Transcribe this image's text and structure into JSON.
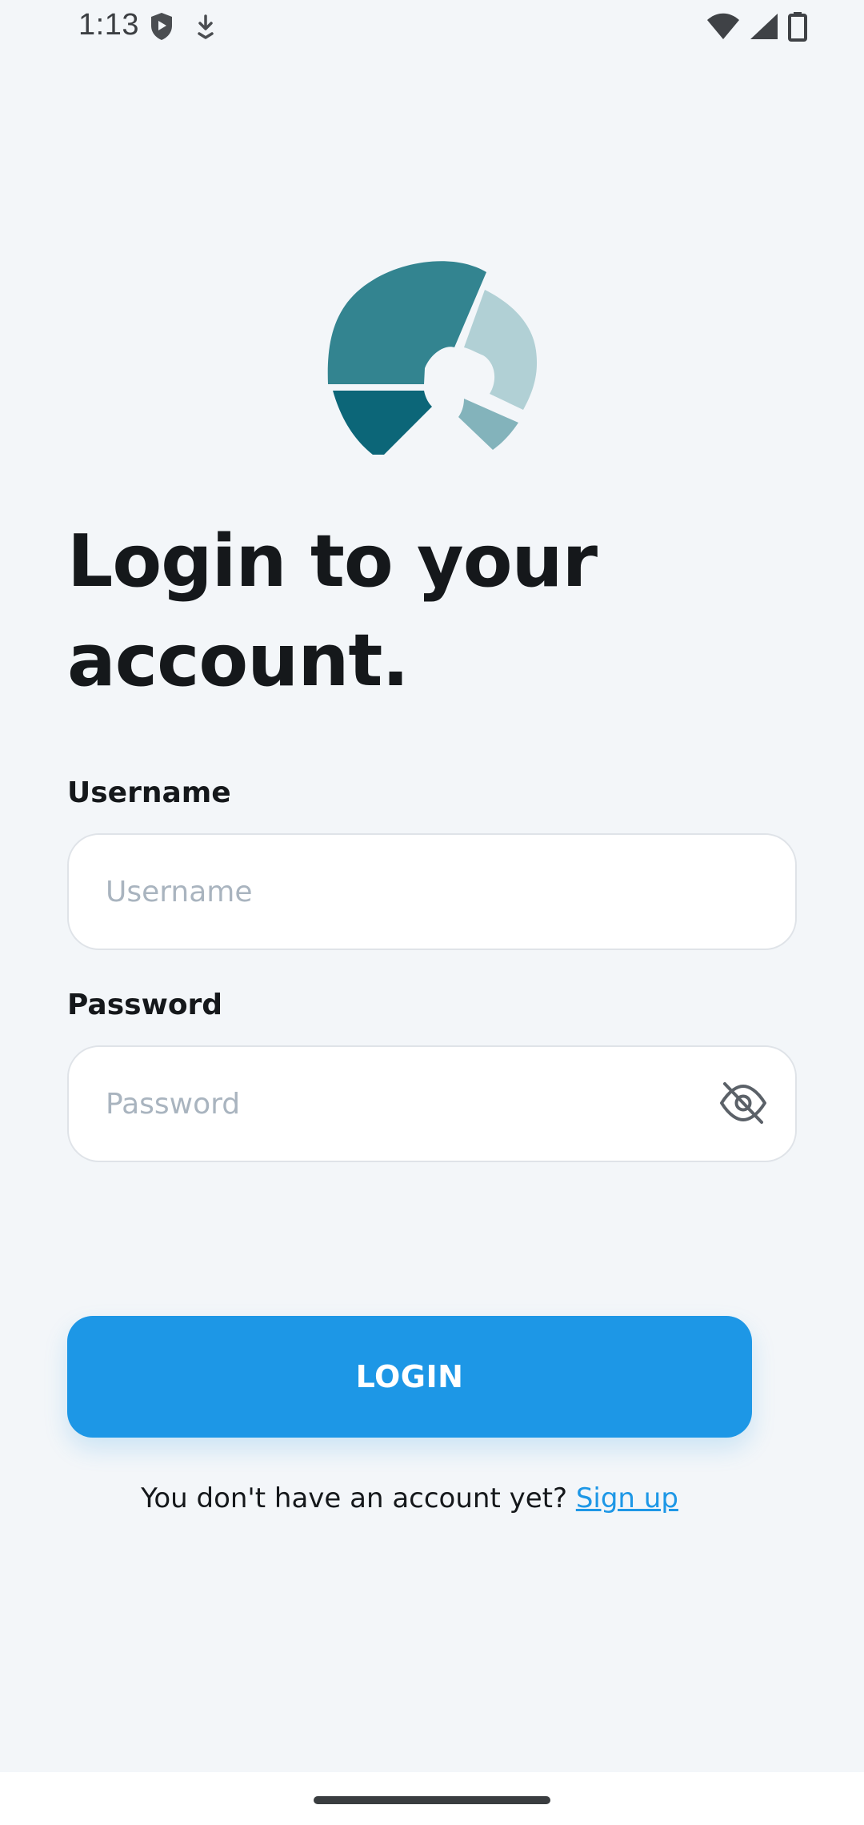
{
  "status_bar": {
    "time": "1:13",
    "icons": [
      "shield-icon",
      "download-icon",
      "wifi-icon",
      "signal-icon",
      "battery-icon"
    ]
  },
  "logo": {
    "name": "app-logo-icon"
  },
  "heading": "Login to your account.",
  "username": {
    "label": "Username",
    "placeholder": "Username",
    "value": ""
  },
  "password": {
    "label": "Password",
    "placeholder": "Password",
    "value": "",
    "toggle_icon": "eye-off-icon"
  },
  "login_button": {
    "label": "LOGIN"
  },
  "signup": {
    "prompt": "You don't have an account yet?",
    "link_label": "Sign up"
  },
  "colors": {
    "background": "#f3f6f9",
    "primary": "#1d97e6",
    "logo_dark": "#0c6678",
    "logo_mid": "#338490",
    "logo_light": "#b1d0d5",
    "logo_soft": "#83b3bb"
  }
}
